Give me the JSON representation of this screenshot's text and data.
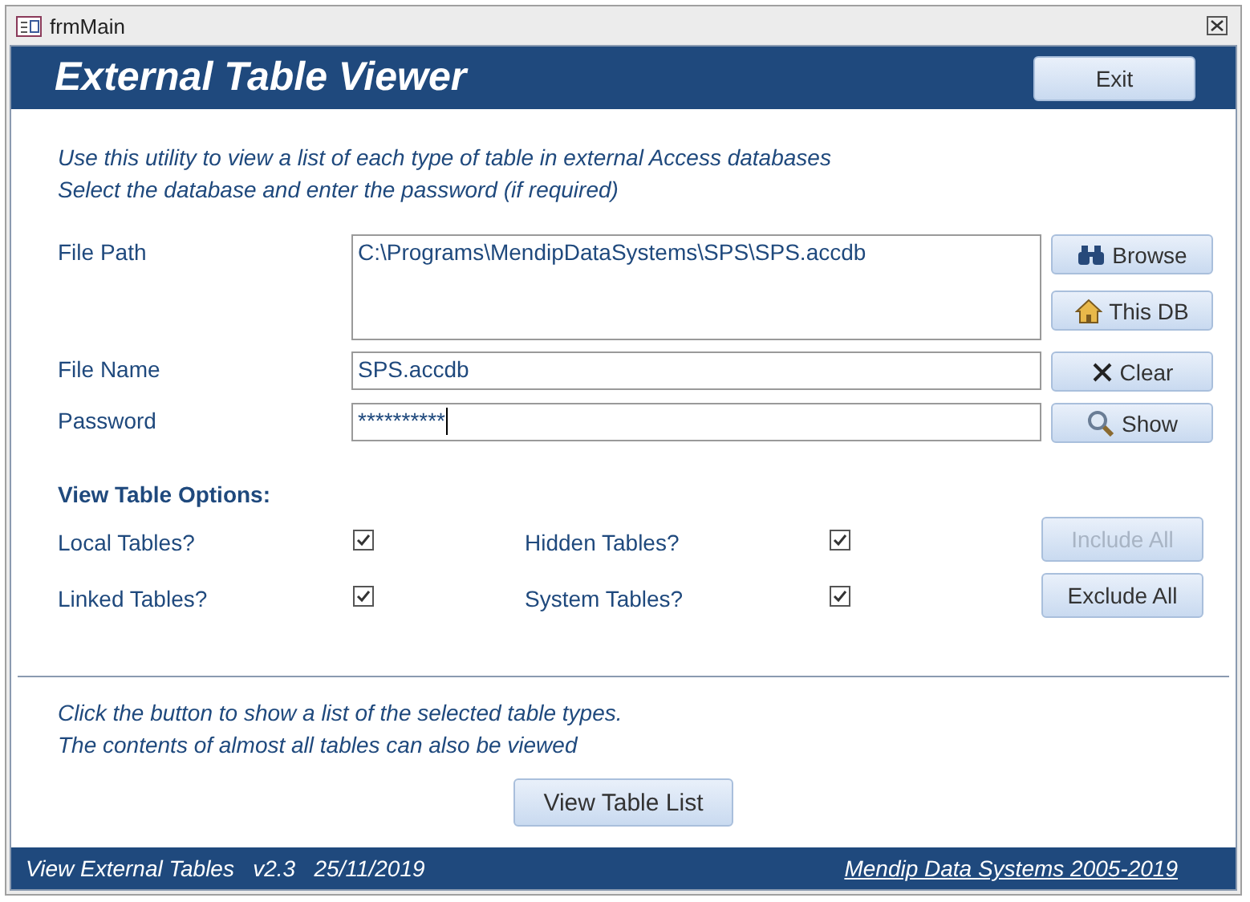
{
  "window": {
    "title": "frmMain"
  },
  "header": {
    "title": "External Table Viewer",
    "exit_button": "Exit"
  },
  "intro": [
    "Use this utility to view a list of each type of table in external Access databases",
    "Select the database and enter the password (if required)"
  ],
  "fields": [
    {
      "kind": "multiline",
      "label": "File Path",
      "value": "C:\\Programs\\MendipDataSystems\\SPS\\SPS.accdb",
      "buttons": [
        {
          "kind": "browse",
          "label": "Browse"
        },
        {
          "kind": "home",
          "label": "This DB"
        }
      ]
    },
    {
      "kind": "text",
      "label": "File Name",
      "value": "SPS.accdb",
      "buttons": [
        {
          "kind": "clear",
          "label": "Clear"
        }
      ]
    },
    {
      "kind": "password",
      "label": "Password",
      "value": "**********",
      "buttons": [
        {
          "kind": "show",
          "label": "Show"
        }
      ]
    }
  ],
  "options": {
    "heading": "View Table Options:",
    "rows": [
      {
        "items": [
          {
            "label": "Local Tables?",
            "checked": true
          },
          {
            "label": "Hidden Tables?",
            "checked": true
          }
        ],
        "button": {
          "label": "Include All",
          "disabled": true
        }
      },
      {
        "items": [
          {
            "label": "Linked Tables?",
            "checked": true
          },
          {
            "label": "System Tables?",
            "checked": true
          }
        ],
        "button": {
          "label": "Exclude All",
          "disabled": false
        }
      }
    ]
  },
  "note": [
    "Click the button to show a list of the selected table types.",
    "The contents of almost all tables can also be viewed"
  ],
  "view_button": "View Table List",
  "footer": {
    "version": "View External Tables   v2.3   25/11/2019",
    "link": "Mendip Data Systems 2005-2019"
  }
}
